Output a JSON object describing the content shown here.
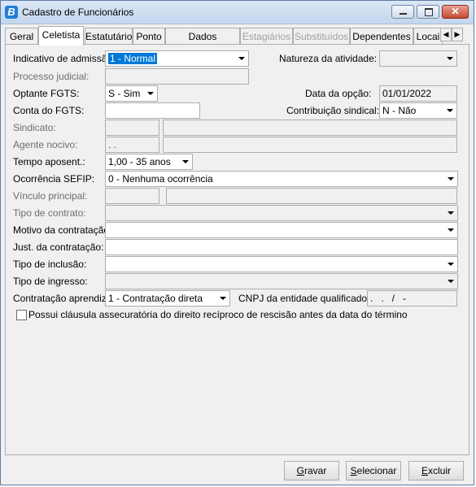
{
  "window": {
    "title": "Cadastro de Funcionários",
    "close_glyph": "✕",
    "app_icon_letter": "B"
  },
  "tabs": [
    {
      "label": "Geral"
    },
    {
      "label": "Celetista"
    },
    {
      "label": "Estatutário"
    },
    {
      "label": "Ponto"
    },
    {
      "label": "Dados adicionais"
    },
    {
      "label": "Estagiários"
    },
    {
      "label": "Substituídos"
    },
    {
      "label": "Dependentes"
    },
    {
      "label": "Locai"
    }
  ],
  "tab_scroll": {
    "left": "◀",
    "right": "▶"
  },
  "form": {
    "indicativo_admissao": {
      "label": "Indicativo de admissão:",
      "value": "1 - Normal"
    },
    "natureza_atividade": {
      "label": "Natureza da atividade:",
      "value": ""
    },
    "processo_judicial": {
      "label": "Processo judicial:",
      "value": ""
    },
    "optante_fgts": {
      "label": "Optante FGTS:",
      "value": "S - Sim"
    },
    "data_opcao": {
      "label": "Data da opção:",
      "value": "01/01/2022"
    },
    "conta_fgts": {
      "label": "Conta do FGTS:",
      "value": ""
    },
    "contribuicao_sindical": {
      "label": "Contribuição sindical:",
      "value": "N - Não"
    },
    "sindicato": {
      "label": "Sindicato:",
      "code": "",
      "name": ""
    },
    "agente_nocivo": {
      "label": "Agente nocivo:",
      "code": ". .",
      "name": ""
    },
    "tempo_aposent": {
      "label": "Tempo aposent.:",
      "value": "1,00 - 35 anos"
    },
    "ocorrencia_sefip": {
      "label": "Ocorrência SEFIP:",
      "value": "0 - Nenhuma ocorrência"
    },
    "vinculo_principal": {
      "label": "Vínculo principal:",
      "code": "",
      "name": ""
    },
    "tipo_contrato": {
      "label": "Tipo de contrato:",
      "value": ""
    },
    "motivo_contratacao": {
      "label": "Motivo da contratação:",
      "value": ""
    },
    "just_contratacao": {
      "label": "Just. da contratação:",
      "value": ""
    },
    "tipo_inclusao": {
      "label": "Tipo de inclusão:",
      "value": ""
    },
    "tipo_ingresso": {
      "label": "Tipo de ingresso:",
      "value": ""
    },
    "contratacao_aprendiz": {
      "label": "Contratação aprendiz:",
      "value": "1 - Contratação direta"
    },
    "cnpj_entidade": {
      "label": "CNPJ da entidade qualificadora:",
      "value": ".   .   /   -"
    },
    "clausula": {
      "label": "Possui cláusula assecuratória do direito recíproco de rescisão antes da data do término",
      "checked": false
    }
  },
  "buttons": {
    "gravar": {
      "u": "G",
      "rest": "ravar"
    },
    "selecionar": {
      "u": "S",
      "rest": "elecionar"
    },
    "excluir": {
      "u": "E",
      "rest": "xcluir"
    }
  }
}
